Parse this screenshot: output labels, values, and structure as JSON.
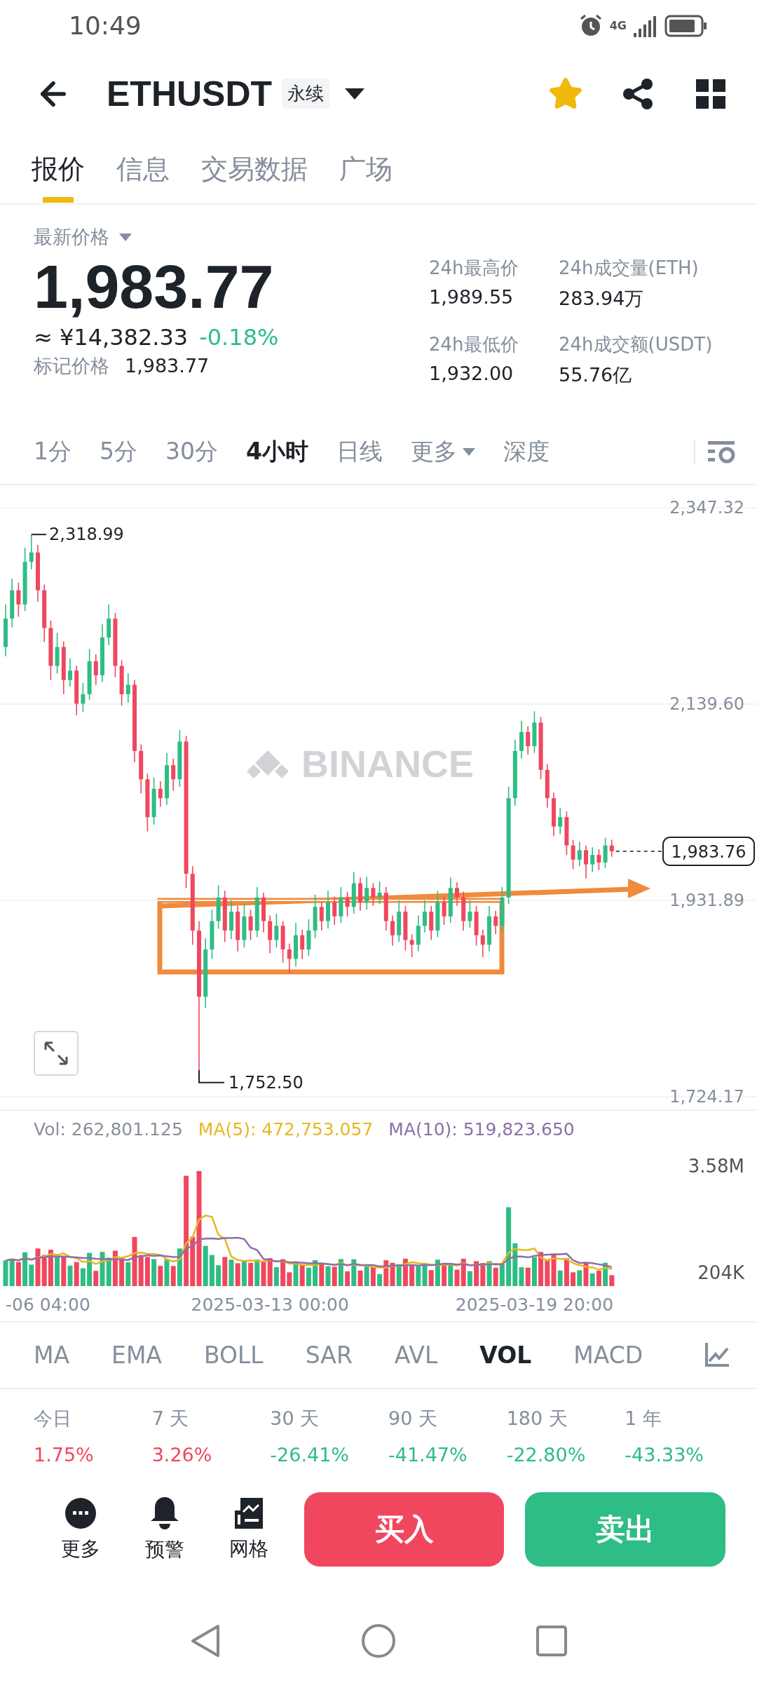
{
  "status_bar": {
    "time": "10:49",
    "network": "4G"
  },
  "header": {
    "symbol": "ETHUSDT",
    "badge": "永续",
    "favorite": true
  },
  "tabs": [
    {
      "label": "报价",
      "selected": true
    },
    {
      "label": "信息",
      "selected": false
    },
    {
      "label": "交易数据",
      "selected": false
    },
    {
      "label": "广场",
      "selected": false
    }
  ],
  "price": {
    "label": "最新价格",
    "last": "1,983.77",
    "fiat": "≈ ¥14,382.33",
    "change": "-0.18%",
    "color": "#2ebd85",
    "mark_label": "标记价格",
    "mark": "1,983.77"
  },
  "stats": [
    {
      "label": "24h最高价",
      "value": "1,989.55"
    },
    {
      "label": "24h成交量(ETH)",
      "value": "283.94万"
    },
    {
      "label": "24h最低价",
      "value": "1,932.00"
    },
    {
      "label": "24h成交额(USDT)",
      "value": "55.76亿"
    }
  ],
  "intervals": [
    {
      "label": "1分",
      "selected": false,
      "kind": "plain"
    },
    {
      "label": "5分",
      "selected": false,
      "kind": "plain"
    },
    {
      "label": "30分",
      "selected": false,
      "kind": "plain"
    },
    {
      "label": "4小时",
      "selected": true,
      "kind": "plain"
    },
    {
      "label": "日线",
      "selected": false,
      "kind": "plain"
    },
    {
      "label": "更多",
      "selected": false,
      "kind": "dropdown"
    },
    {
      "label": "深度",
      "selected": false,
      "kind": "plain"
    }
  ],
  "chart": {
    "watermark": "BINANCE",
    "high_label": "2,318.99",
    "low_label": "1,752.50",
    "current_price": "1,983.76",
    "chart_data": {
      "type": "candlestick",
      "ylim": [
        1724.17,
        2347.32
      ],
      "yticks": [
        {
          "value": 2347.32,
          "label": "2,347.32"
        },
        {
          "value": 2139.6,
          "label": "2,139.60"
        },
        {
          "value": 1931.89,
          "label": "1,931.89"
        },
        {
          "value": 1724.17,
          "label": "1,724.17"
        }
      ],
      "ohlc": [
        [
          2200,
          2245,
          2190,
          2230
        ],
        [
          2230,
          2272,
          2221,
          2260
        ],
        [
          2260,
          2268,
          2232,
          2245
        ],
        [
          2245,
          2305,
          2238,
          2290
        ],
        [
          2290,
          2318.99,
          2282,
          2300
        ],
        [
          2300,
          2308,
          2248,
          2260
        ],
        [
          2260,
          2266,
          2205,
          2220
        ],
        [
          2220,
          2228,
          2165,
          2180
        ],
        [
          2180,
          2215,
          2172,
          2200
        ],
        [
          2200,
          2206,
          2150,
          2165
        ],
        [
          2165,
          2188,
          2158,
          2175
        ],
        [
          2175,
          2180,
          2128,
          2140
        ],
        [
          2140,
          2162,
          2131,
          2150
        ],
        [
          2150,
          2198,
          2144,
          2185
        ],
        [
          2185,
          2192,
          2160,
          2170
        ],
        [
          2170,
          2224,
          2163,
          2210
        ],
        [
          2210,
          2245,
          2202,
          2230
        ],
        [
          2230,
          2236,
          2168,
          2180
        ],
        [
          2180,
          2186,
          2138,
          2150
        ],
        [
          2150,
          2172,
          2141,
          2160
        ],
        [
          2160,
          2165,
          2078,
          2090
        ],
        [
          2090,
          2097,
          2045,
          2060
        ],
        [
          2060,
          2066,
          2005,
          2020
        ],
        [
          2020,
          2062,
          2012,
          2050
        ],
        [
          2050,
          2058,
          2031,
          2040
        ],
        [
          2040,
          2088,
          2033,
          2075
        ],
        [
          2075,
          2082,
          2048,
          2060
        ],
        [
          2060,
          2112,
          2052,
          2100
        ],
        [
          2100,
          2106,
          1945,
          1960
        ],
        [
          1960,
          1968,
          1885,
          1900
        ],
        [
          1900,
          1910,
          1752.5,
          1830
        ],
        [
          1830,
          1892,
          1818,
          1880
        ],
        [
          1880,
          1922,
          1870,
          1910
        ],
        [
          1910,
          1948,
          1902,
          1935
        ],
        [
          1935,
          1942,
          1888,
          1900
        ],
        [
          1900,
          1932,
          1891,
          1920
        ],
        [
          1920,
          1926,
          1878,
          1890
        ],
        [
          1890,
          1928,
          1882,
          1915
        ],
        [
          1915,
          1922,
          1890,
          1900
        ],
        [
          1900,
          1946,
          1893,
          1935
        ],
        [
          1935,
          1940,
          1898,
          1910
        ],
        [
          1910,
          1916,
          1876,
          1890
        ],
        [
          1890,
          1918,
          1882,
          1905
        ],
        [
          1905,
          1910,
          1866,
          1880
        ],
        [
          1880,
          1886,
          1855,
          1870
        ],
        [
          1870,
          1908,
          1862,
          1895
        ],
        [
          1895,
          1901,
          1870,
          1880
        ],
        [
          1880,
          1912,
          1873,
          1900
        ],
        [
          1900,
          1938,
          1892,
          1925
        ],
        [
          1925,
          1930,
          1900,
          1910
        ],
        [
          1910,
          1942,
          1902,
          1930
        ],
        [
          1930,
          1936,
          1906,
          1915
        ],
        [
          1915,
          1946,
          1908,
          1935
        ],
        [
          1935,
          1941,
          1915,
          1925
        ],
        [
          1925,
          1962,
          1918,
          1950
        ],
        [
          1950,
          1956,
          1921,
          1930
        ],
        [
          1930,
          1957,
          1922,
          1945
        ],
        [
          1945,
          1950,
          1926,
          1935
        ],
        [
          1935,
          1952,
          1928,
          1940
        ],
        [
          1940,
          1946,
          1900,
          1910
        ],
        [
          1910,
          1916,
          1884,
          1895
        ],
        [
          1895,
          1932,
          1888,
          1920
        ],
        [
          1920,
          1926,
          1879,
          1890
        ],
        [
          1890,
          1896,
          1872,
          1885
        ],
        [
          1885,
          1916,
          1878,
          1905
        ],
        [
          1905,
          1932,
          1898,
          1920
        ],
        [
          1920,
          1926,
          1890,
          1900
        ],
        [
          1900,
          1942,
          1893,
          1930
        ],
        [
          1930,
          1936,
          1906,
          1915
        ],
        [
          1915,
          1956,
          1908,
          1945
        ],
        [
          1945,
          1951,
          1926,
          1935
        ],
        [
          1935,
          1941,
          1900,
          1910
        ],
        [
          1910,
          1932,
          1903,
          1920
        ],
        [
          1920,
          1926,
          1884,
          1895
        ],
        [
          1895,
          1901,
          1872,
          1885
        ],
        [
          1885,
          1926,
          1878,
          1915
        ],
        [
          1915,
          1921,
          1896,
          1905
        ],
        [
          1905,
          1946,
          1898,
          1935
        ],
        [
          1935,
          2052,
          1928,
          2040
        ],
        [
          2040,
          2102,
          2032,
          2090
        ],
        [
          2090,
          2122,
          2082,
          2110
        ],
        [
          2110,
          2116,
          2086,
          2095
        ],
        [
          2095,
          2132,
          2088,
          2120
        ],
        [
          2120,
          2126,
          2060,
          2070
        ],
        [
          2070,
          2076,
          2030,
          2040
        ],
        [
          2040,
          2046,
          2000,
          2010
        ],
        [
          2010,
          2030,
          2002,
          2020
        ],
        [
          2020,
          2026,
          1980,
          1990
        ],
        [
          1990,
          1996,
          1965,
          1975
        ],
        [
          1975,
          1994,
          1968,
          1985
        ],
        [
          1985,
          1990,
          1955,
          1970
        ],
        [
          1970,
          1988,
          1962,
          1980
        ],
        [
          1980,
          1986,
          1964,
          1972
        ],
        [
          1972,
          1998,
          1966,
          1990
        ],
        [
          1990,
          1996,
          1978,
          1983.76
        ]
      ]
    },
    "volume_legend": [
      {
        "text": "Vol: 262,801.125",
        "color": "#8a8f98"
      },
      {
        "text": "MA(5): 472,753.057",
        "color": "#e6b81f"
      },
      {
        "text": "MA(10): 519,823.650",
        "color": "#8e6fa8"
      }
    ],
    "volume_axis": [
      "3.58M",
      "204K"
    ],
    "time_axis": [
      "-06 04:00",
      "2025-03-13 00:00",
      "2025-03-19 20:00"
    ]
  },
  "indicators": [
    {
      "label": "MA",
      "selected": false
    },
    {
      "label": "EMA",
      "selected": false
    },
    {
      "label": "BOLL",
      "selected": false
    },
    {
      "label": "SAR",
      "selected": false
    },
    {
      "label": "AVL",
      "selected": false
    },
    {
      "label": "VOL",
      "selected": true
    },
    {
      "label": "MACD",
      "selected": false
    }
  ],
  "performance": [
    {
      "period": "今日",
      "value": "1.75%",
      "color": "#f0475f"
    },
    {
      "period": "7 天",
      "value": "3.26%",
      "color": "#f0475f"
    },
    {
      "period": "30 天",
      "value": "-26.41%",
      "color": "#2ebd85"
    },
    {
      "period": "90 天",
      "value": "-41.47%",
      "color": "#2ebd85"
    },
    {
      "period": "180 天",
      "value": "-22.80%",
      "color": "#2ebd85"
    },
    {
      "period": "1 年",
      "value": "-43.33%",
      "color": "#2ebd85"
    }
  ],
  "actions": [
    {
      "label": "更多",
      "kind": "more"
    },
    {
      "label": "预警",
      "kind": "alert"
    },
    {
      "label": "网格",
      "kind": "grid"
    }
  ],
  "trade_buttons": [
    {
      "label": "买入",
      "color": "#f0475f"
    },
    {
      "label": "卖出",
      "color": "#2ebd85"
    }
  ]
}
